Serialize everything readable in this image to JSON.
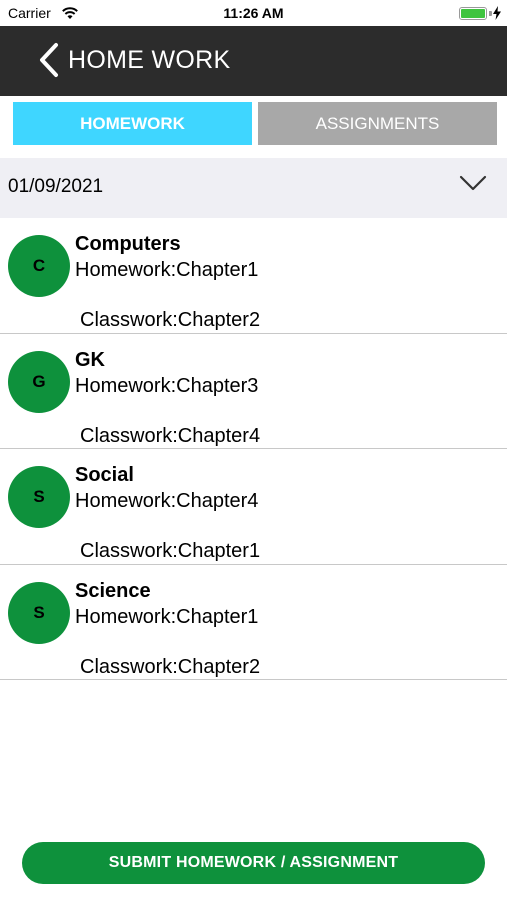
{
  "status_bar": {
    "carrier": "Carrier",
    "time": "11:26 AM",
    "battery_level": 1.0,
    "charging": true
  },
  "header": {
    "title": "HOME WORK",
    "back_icon": "chevron-left-icon"
  },
  "tabs": [
    {
      "label": "HOMEWORK",
      "active": true
    },
    {
      "label": "ASSIGNMENTS",
      "active": false
    }
  ],
  "date_selector": {
    "value": "01/09/2021",
    "icon": "chevron-down-icon"
  },
  "subjects": [
    {
      "initial": "C",
      "name": "Computers",
      "homework": "Homework:Chapter1",
      "classwork": "Classwork:Chapter2"
    },
    {
      "initial": "G",
      "name": "GK",
      "homework": "Homework:Chapter3",
      "classwork": "Classwork:Chapter4"
    },
    {
      "initial": "S",
      "name": "Social",
      "homework": "Homework:Chapter4",
      "classwork": "Classwork:Chapter1"
    },
    {
      "initial": "S",
      "name": "Science",
      "homework": "Homework:Chapter1",
      "classwork": "Classwork:Chapter2"
    }
  ],
  "submit_button": {
    "label": "SUBMIT HOMEWORK / ASSIGNMENT"
  },
  "colors": {
    "navbar": "#2c2c2c",
    "tab_active": "#3fd6ff",
    "tab_inactive": "#a8a8a8",
    "avatar": "#0e913c",
    "submit_button": "#0e913c",
    "date_row_bg": "#efeff4"
  }
}
